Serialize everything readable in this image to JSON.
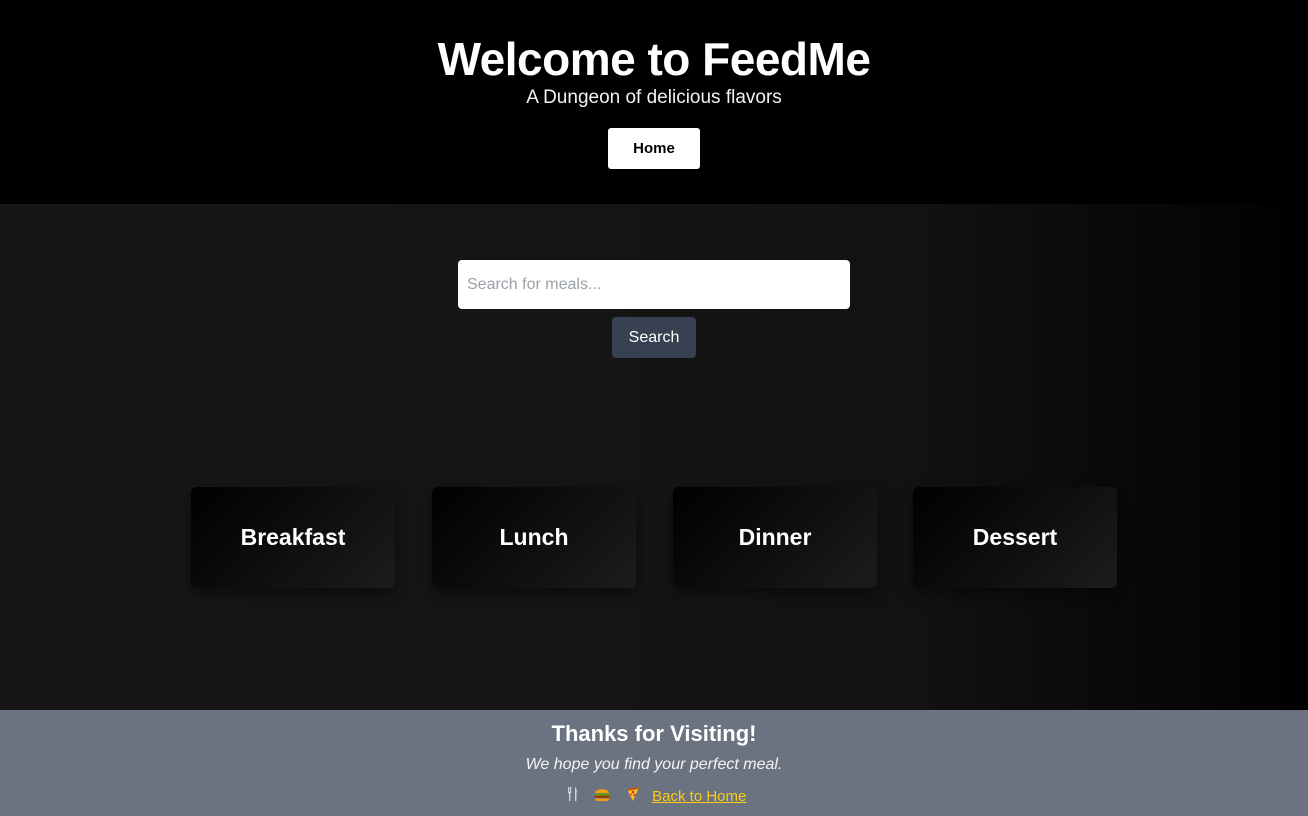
{
  "header": {
    "title": "Welcome to FeedMe",
    "subtitle": "A Dungeon of delicious flavors",
    "home_label": "Home"
  },
  "search": {
    "placeholder": "Search for meals...",
    "value": "",
    "button_label": "Search"
  },
  "categories": [
    {
      "label": "Breakfast"
    },
    {
      "label": "Lunch"
    },
    {
      "label": "Dinner"
    },
    {
      "label": "Dessert"
    }
  ],
  "footer": {
    "title": "Thanks for Visiting!",
    "tagline": "We hope you find your perfect meal.",
    "icons": [
      "fork-knife-icon",
      "burger-icon",
      "pizza-icon"
    ],
    "back_link": "Back to Home"
  },
  "colors": {
    "header_bg": "#000000",
    "main_bg": "#161616",
    "footer_bg": "#6b7280",
    "search_button_bg": "#374151",
    "link_color": "#facc15"
  }
}
